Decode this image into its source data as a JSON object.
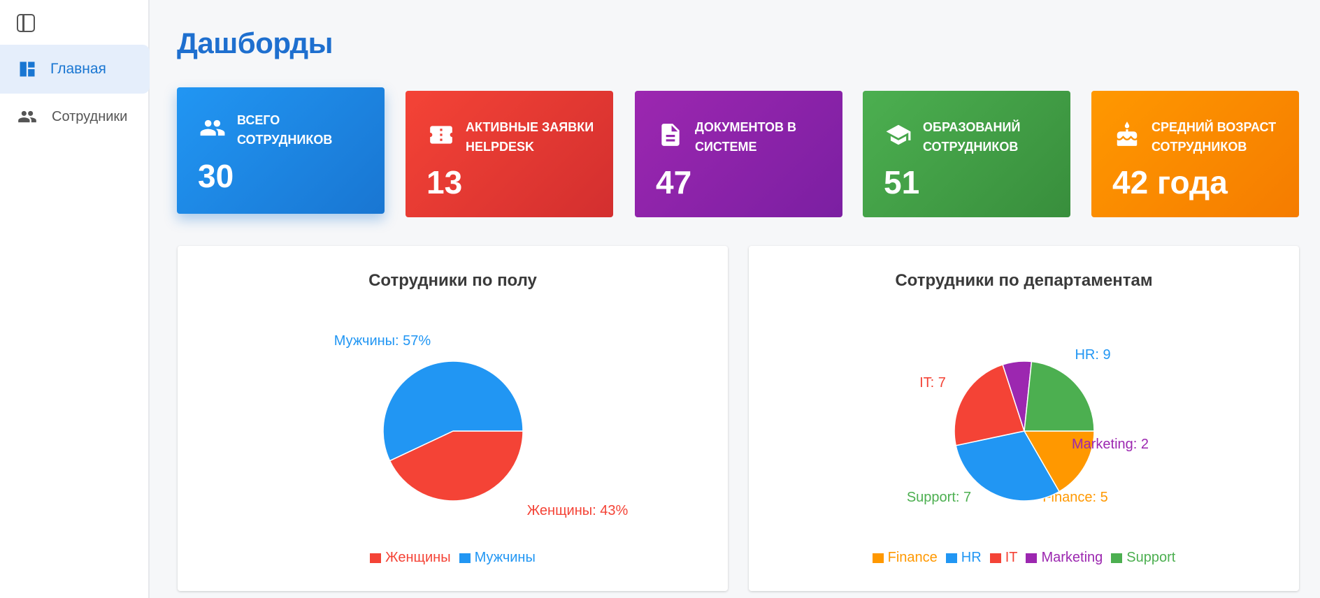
{
  "sidebar": {
    "items": [
      {
        "label": "Главная",
        "icon": "dashboard-icon"
      },
      {
        "label": "Сотрудники",
        "icon": "people-icon"
      }
    ]
  },
  "header": {
    "title": "Дашборды"
  },
  "cards": [
    {
      "label": "ВСЕГО СОТРУДНИКОВ",
      "value": "30",
      "icon": "people-icon",
      "color": "#1e88e5"
    },
    {
      "label": "АКТИВНЫЕ ЗАЯВКИ HELPDESK",
      "value": "13",
      "icon": "ticket-icon",
      "color": "#e53935"
    },
    {
      "label": "ДОКУМЕНТОВ В СИСТЕМЕ",
      "value": "47",
      "icon": "document-icon",
      "color": "#8e24aa"
    },
    {
      "label": "ОБРАЗОВАНИЙ СОТРУДНИКОВ",
      "value": "51",
      "icon": "graduation-cap-icon",
      "color": "#43a047"
    },
    {
      "label": "СРЕДНИЙ ВОЗРАСТ СОТРУДНИКОВ",
      "value": "42 года",
      "icon": "cake-icon",
      "color": "#fb8c00"
    }
  ],
  "chart_data": [
    {
      "type": "pie",
      "title": "Сотрудники по полу",
      "slices": [
        {
          "name": "Женщины",
          "value": 43,
          "label": "Женщины: 43%",
          "color": "#f44336"
        },
        {
          "name": "Мужчины",
          "value": 57,
          "label": "Мужчины: 57%",
          "color": "#2196f3"
        }
      ],
      "legend": "bottom"
    },
    {
      "type": "pie",
      "title": "Сотрудники по департаментам",
      "slices": [
        {
          "name": "Finance",
          "value": 5,
          "label": "Finance: 5",
          "color": "#ff9800"
        },
        {
          "name": "HR",
          "value": 9,
          "label": "HR: 9",
          "color": "#2196f3"
        },
        {
          "name": "IT",
          "value": 7,
          "label": "IT: 7",
          "color": "#f44336"
        },
        {
          "name": "Marketing",
          "value": 2,
          "label": "Marketing: 2",
          "color": "#9c27b0"
        },
        {
          "name": "Support",
          "value": 7,
          "label": "Support: 7",
          "color": "#4caf50"
        }
      ],
      "legend": "bottom"
    }
  ]
}
